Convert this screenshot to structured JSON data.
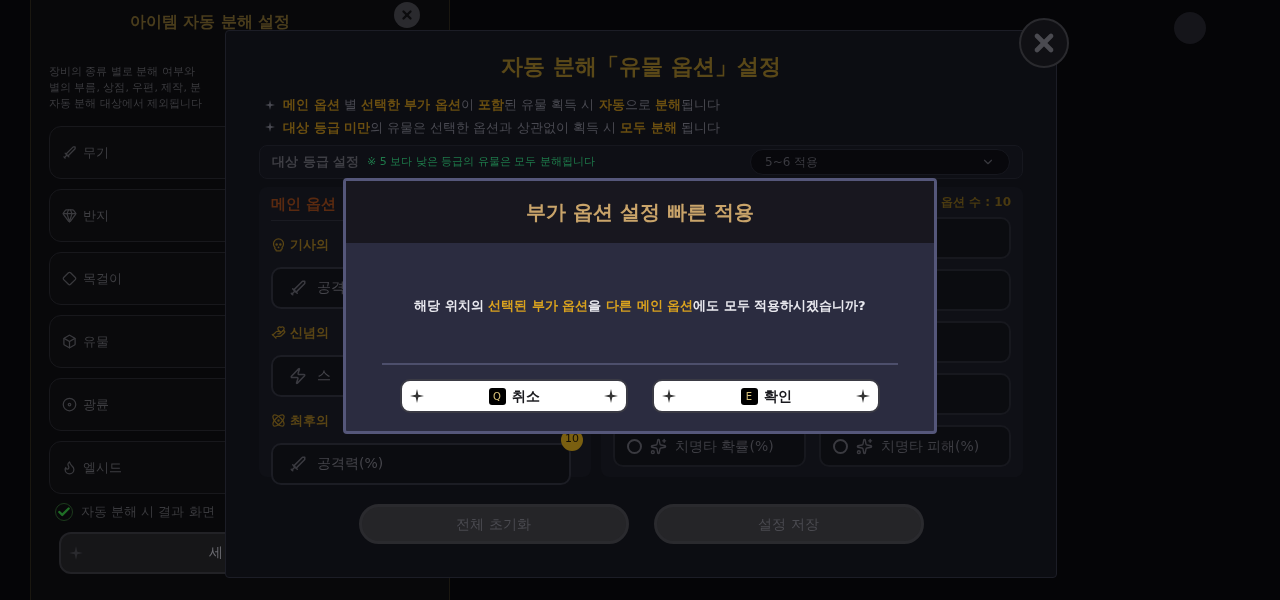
{
  "background_panel": {
    "title": "아이템 자동 분해 설정",
    "description": [
      "장비의 종류 별로 분해 여부와",
      "별의 부름, 상점, 우편, 제작, 분",
      "자동 분해 대상에서 제외됩니다"
    ],
    "categories": [
      {
        "label": "무기",
        "kind": "weapon"
      },
      {
        "label": "반지",
        "kind": "ring"
      },
      {
        "label": "목걸이",
        "kind": "necklace"
      },
      {
        "label": "유물",
        "kind": "artifact"
      },
      {
        "label": "광륜",
        "kind": "halo"
      },
      {
        "label": "엘시드",
        "kind": "elcid"
      }
    ],
    "checkbox": {
      "label": "자동 분해 시 결과 화면",
      "checked": true
    },
    "button": {
      "label": "세"
    }
  },
  "settings_dialog": {
    "title": "자동 분해「유물 옵션」설정",
    "notes": [
      "**메인 옵션** 별 **선택한 부가 옵션**이 **포함**된 유물 획득 시 **자동**으로 **분해**됩니다",
      "**대상 등급 미만**의 유물은 선택한 옵션과 상관없이 획득 시 **모두 분해** 됩니다"
    ],
    "grade_setting": {
      "label": "대상 등급 설정",
      "hint": "※ 5 보다 낮은 등급의 유물은 모두 분해됩니다",
      "dropdown": "5~6 적용"
    },
    "main_options": {
      "header": "메인 옵션",
      "groups": [
        {
          "name": "기사의",
          "option": {
            "label": "공격"
          }
        },
        {
          "name": "신념의",
          "option": {
            "label": "스"
          }
        },
        {
          "name": "최후의",
          "option": {
            "label": "공격력(%)",
            "badge": "10"
          }
        }
      ]
    },
    "sub_options": {
      "count_label": "옵션 수 : 10",
      "slots": [
        {
          "label": "치명타 확률(%)",
          "selected": false
        },
        {
          "label": "치명타 피해(%)",
          "selected": false
        }
      ]
    },
    "buttons": [
      "전체 초기화",
      "설정 저장"
    ]
  },
  "confirm_popup": {
    "title": "부가 옵션 설정 빠른 적용",
    "message": "해당 위치의 **선택된 부가 옵션**을 **다른 메인 옵션**에도 모두 적용하시겠습니까?",
    "buttons": [
      {
        "key": "Q",
        "label": "취소"
      },
      {
        "key": "E",
        "label": "확인"
      }
    ]
  }
}
